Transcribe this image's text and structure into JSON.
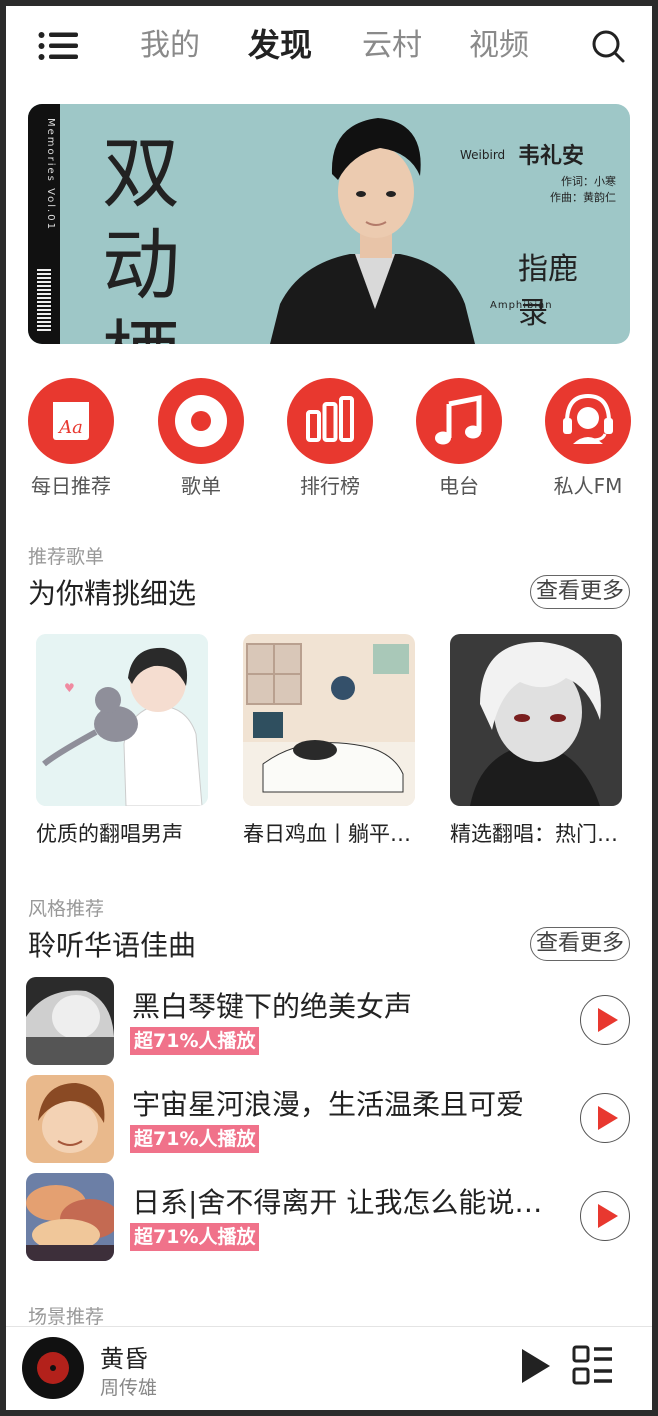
{
  "header": {
    "tabs": [
      {
        "label": "我的",
        "active": false
      },
      {
        "label": "发现",
        "active": true
      },
      {
        "label": "云村",
        "active": false
      },
      {
        "label": "视频",
        "active": false
      }
    ],
    "menu_icon": "menu-icon",
    "search_icon": "search-icon"
  },
  "banner": {
    "title": "双动栖物",
    "strip_text": "Memories  Vol.01",
    "artist_en": "Weibird",
    "artist_cn": "韦礼安",
    "lyricist": "作词：小寒",
    "composer": "作曲：黄韵仁",
    "logo_text": "指鹿录",
    "album_en": "Amphibian"
  },
  "nav": [
    {
      "label": "每日推荐",
      "icon": "calendar-icon"
    },
    {
      "label": "歌单",
      "icon": "playlist-disc-icon"
    },
    {
      "label": "排行榜",
      "icon": "chart-bars-icon"
    },
    {
      "label": "电台",
      "icon": "music-note-icon"
    },
    {
      "label": "私人FM",
      "icon": "headset-icon"
    }
  ],
  "recommend": {
    "subtitle": "推荐歌单",
    "title": "为你精挑细选",
    "more": "查看更多",
    "cards": [
      {
        "title": "优质的翻唱男声"
      },
      {
        "title": "春日鸡血丨躺平也能燃起来"
      },
      {
        "title": "精选翻唱：热门歌曲翻唱合集"
      }
    ]
  },
  "style": {
    "subtitle": "风格推荐",
    "title": "聆听华语佳曲",
    "more": "查看更多",
    "songs": [
      {
        "title": "黑白琴键下的绝美女声",
        "badge": "超71%人播放"
      },
      {
        "title": "宇宙星河浪漫，生活温柔且可爱",
        "badge": "超71%人播放"
      },
      {
        "title": "日系|舍不得离开 让我怎么能说再见",
        "badge": "超71%人播放"
      }
    ]
  },
  "scene": {
    "subtitle": "场景推荐"
  },
  "player": {
    "title": "黄昏",
    "artist": "周传雄"
  },
  "colors": {
    "accent": "#e8382f",
    "badge": "#f0728a"
  }
}
